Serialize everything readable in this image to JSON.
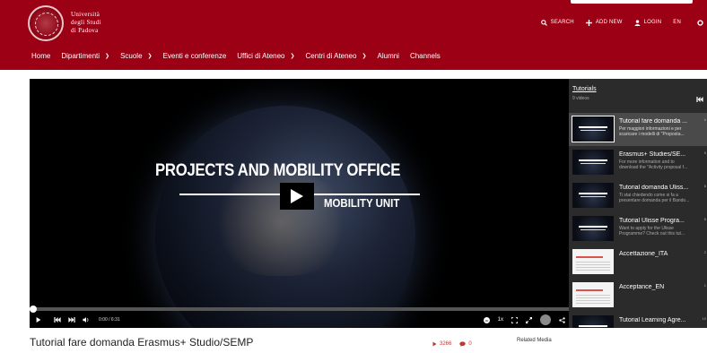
{
  "header": {
    "logo_lines": [
      "Università",
      "degli Studi",
      "di Padova"
    ],
    "actions": [
      {
        "label": "SEARCH",
        "icon": "search-icon"
      },
      {
        "label": "ADD NEW",
        "icon": "plus-icon"
      },
      {
        "label": "LOGIN",
        "icon": "user-icon"
      },
      {
        "label": "EN",
        "icon": ""
      }
    ],
    "nav": [
      {
        "label": "Home",
        "dropdown": false
      },
      {
        "label": "Dipartimenti",
        "dropdown": true
      },
      {
        "label": "Scuole",
        "dropdown": true
      },
      {
        "label": "Eventi e conferenze",
        "dropdown": false
      },
      {
        "label": "Uffici di Ateneo",
        "dropdown": true
      },
      {
        "label": "Centri di Ateneo",
        "dropdown": true
      },
      {
        "label": "Alumni",
        "dropdown": false
      },
      {
        "label": "Channels",
        "dropdown": false
      }
    ]
  },
  "player": {
    "video_title": "PROJECTS AND MOBILITY OFFICE",
    "video_subtitle": "MOBILITY UNIT",
    "time": "0:00 / 6:31",
    "speed": "1x",
    "progress": 0
  },
  "playlist": {
    "title": "Tutorials",
    "count": "9 videos",
    "items": [
      {
        "name": "Tutorial fare domanda ...",
        "desc1": "Per maggiori informazioni e per",
        "desc2": "scaricare i modelli di \"Proposta...",
        "duration": "6",
        "thumb": "dark",
        "active": true
      },
      {
        "name": "Erasmus+ Studies/SE...",
        "desc1": "For more information and to",
        "desc2": "download the \"Activity proposal f...",
        "duration": "5",
        "thumb": "dark",
        "active": false
      },
      {
        "name": "Tutorial domanda Uliss...",
        "desc1": "Ti stai chiedendo come si fa a",
        "desc2": "presentare domanda per il Bando...",
        "duration": "6",
        "thumb": "dark",
        "active": false
      },
      {
        "name": "Tutorial Ulisse Progra...",
        "desc1": "Want to apply for the Ulisse",
        "desc2": "Programme? Check out this tut...",
        "duration": "6",
        "thumb": "dark",
        "active": false
      },
      {
        "name": "Accettazione_ITA",
        "desc1": "",
        "desc2": "",
        "duration": "2",
        "thumb": "light",
        "active": false
      },
      {
        "name": "Acceptance_EN",
        "desc1": "",
        "desc2": "",
        "duration": "1",
        "thumb": "light",
        "active": false
      },
      {
        "name": "Tutorial Learning Agre...",
        "desc1": "",
        "desc2": "",
        "duration": "10",
        "thumb": "dark",
        "active": false
      }
    ]
  },
  "media": {
    "title": "Tutorial fare domanda Erasmus+ Studio/SEMP",
    "plays": "3266",
    "comments": "0",
    "related_label": "Related Media"
  },
  "colors": {
    "brand": "#9b0014",
    "stat_red": "#c0392b"
  }
}
